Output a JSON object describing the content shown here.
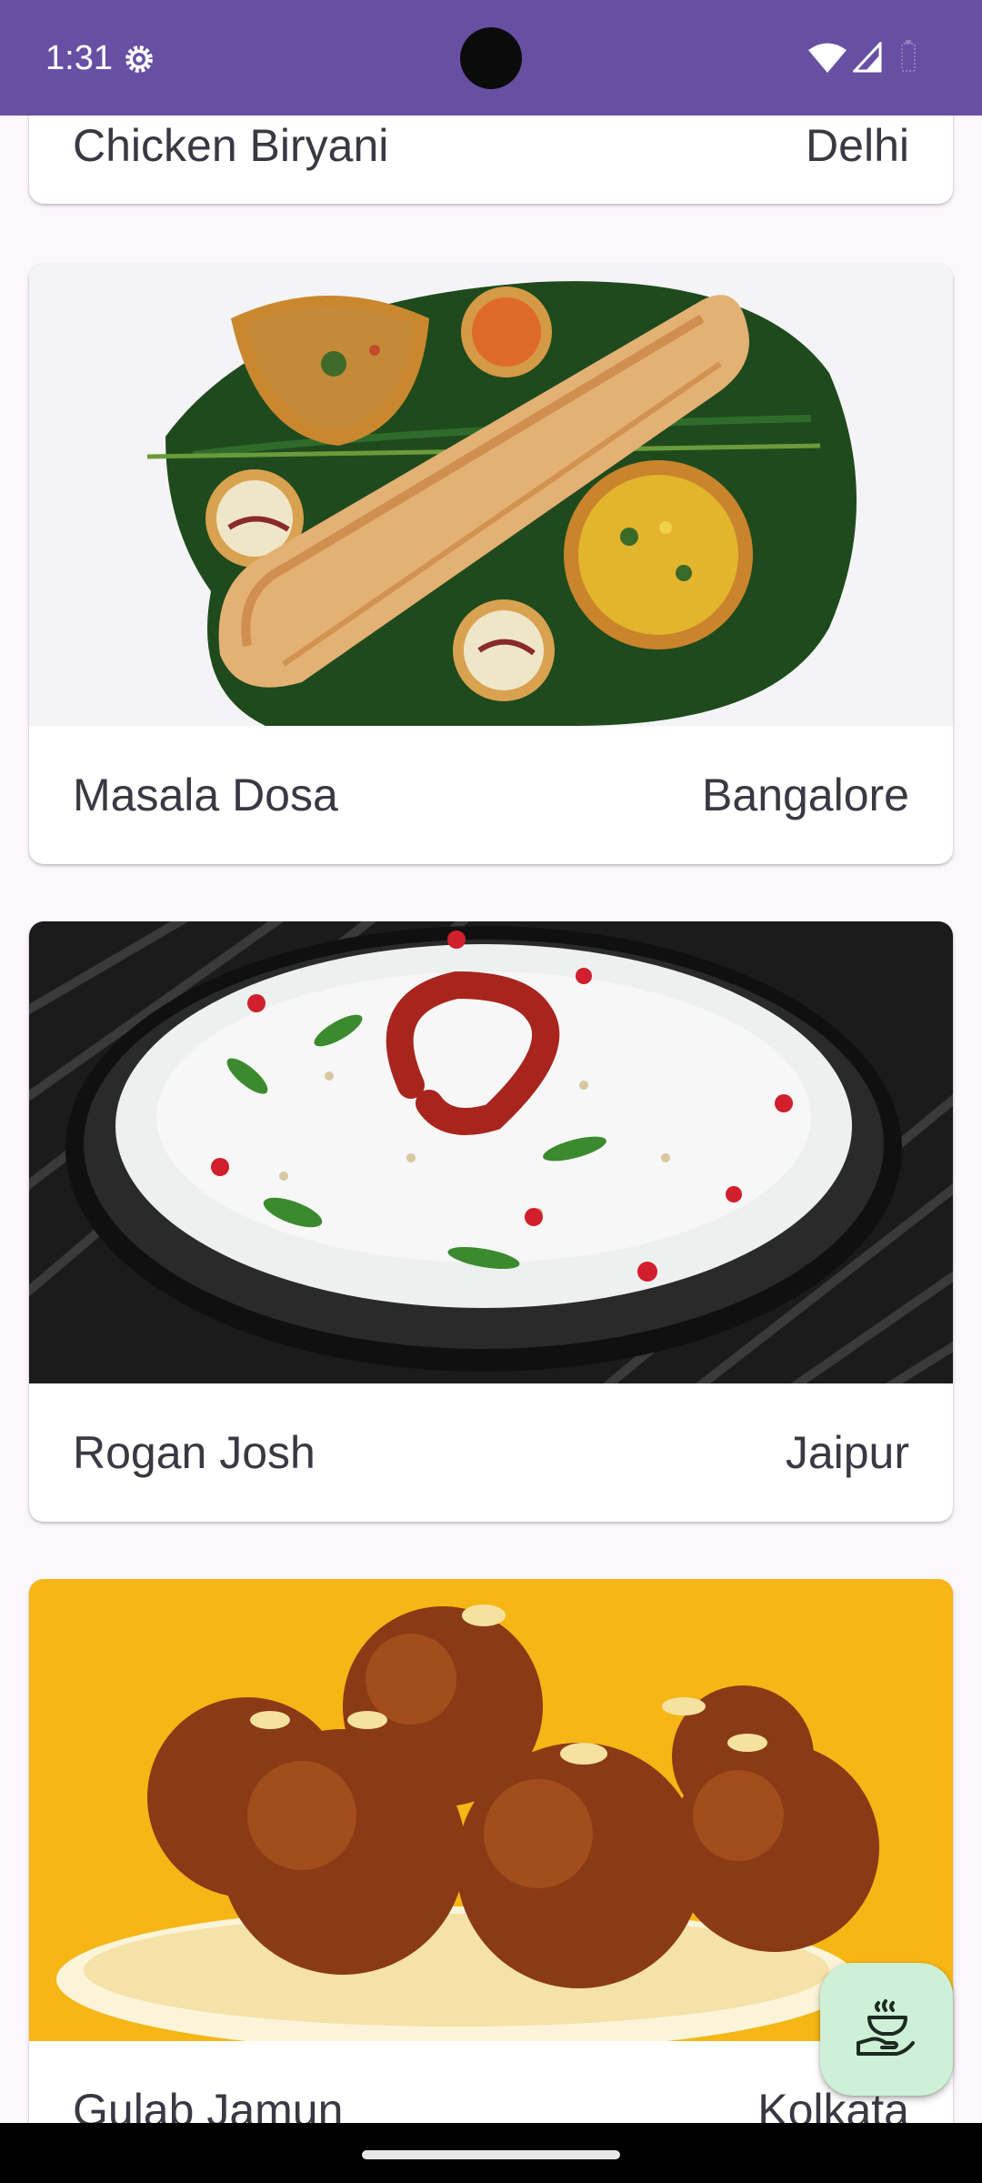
{
  "status_bar": {
    "time": "1:31",
    "background": "#6750a4",
    "icons": [
      "settings-gear-icon",
      "wifi-icon",
      "cell-signal-icon",
      "battery-icon"
    ]
  },
  "dishes": [
    {
      "name": "Chicken Biryani",
      "city": "Delhi"
    },
    {
      "name": "Masala Dosa",
      "city": "Bangalore",
      "photo": "masala-dosa-on-banana-leaf"
    },
    {
      "name": "Rogan Josh",
      "city": "Jaipur",
      "photo": "curd-rice-bowl-with-red-chili"
    },
    {
      "name": "Gulab Jamun",
      "city": "Kolkata",
      "photo": "gulab-jamun-bowl-on-yellow"
    }
  ],
  "fab": {
    "icon": "serving-hand-icon",
    "background": "#cdf0d6"
  },
  "colors": {
    "page_background": "#fcf7fc",
    "card_background": "#ffffff",
    "text": "#3b3843"
  }
}
